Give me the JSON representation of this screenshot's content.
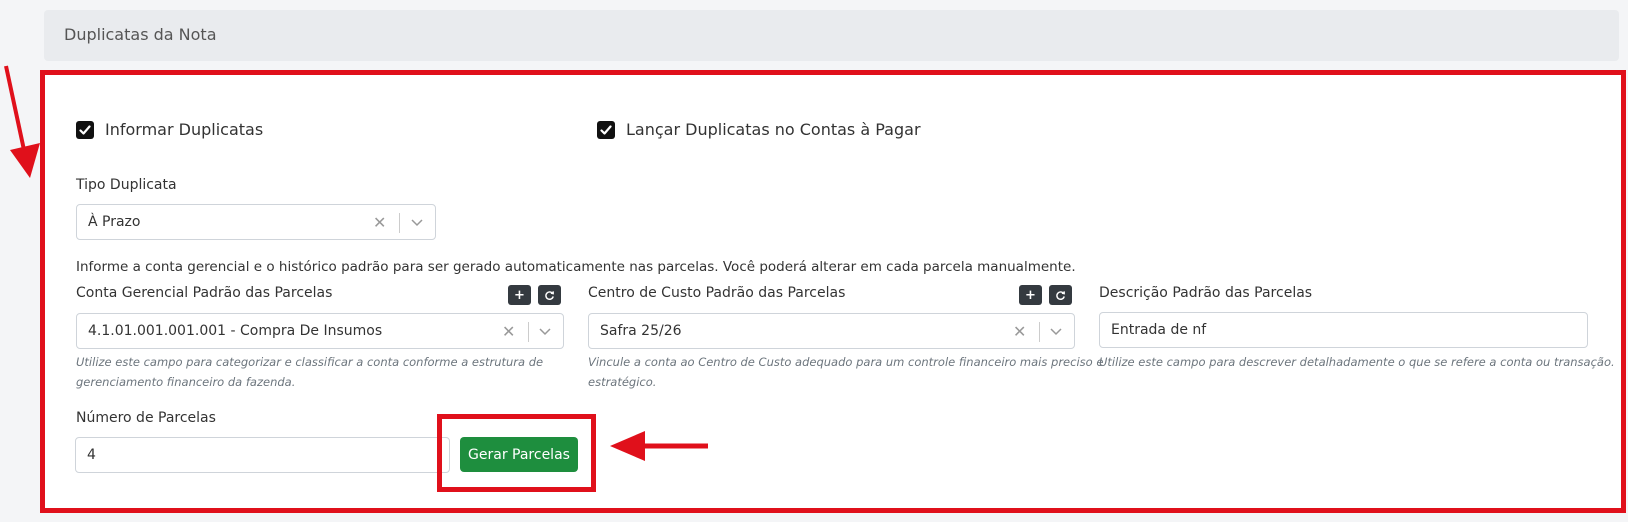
{
  "header": {
    "title": "Duplicatas da Nota"
  },
  "checkboxes": {
    "informar": {
      "label": "Informar Duplicatas",
      "checked": true
    },
    "lancar": {
      "label": "Lançar Duplicatas no Contas à Pagar",
      "checked": true
    }
  },
  "tipo_duplicata": {
    "label": "Tipo Duplicata",
    "value": "À Prazo"
  },
  "info_text": "Informe a conta gerencial e o histórico padrão para ser gerado automaticamente nas parcelas. Você poderá alterar em cada parcela manualmente.",
  "conta_gerencial": {
    "label": "Conta Gerencial Padrão das Parcelas",
    "value": "4.1.01.001.001.001 - Compra De Insumos",
    "help_line1": "Utilize este campo para categorizar e classificar a conta conforme a estrutura de",
    "help_line2": "gerenciamento financeiro da fazenda."
  },
  "centro_custo": {
    "label": "Centro de Custo Padrão das Parcelas",
    "value": "Safra 25/26",
    "help_line1": "Vincule a conta ao Centro de Custo adequado para um controle financeiro mais preciso e",
    "help_line2": "estratégico."
  },
  "descricao": {
    "label": "Descrição Padrão das Parcelas",
    "value": "Entrada de nf",
    "help": "Utilize este campo para descrever detalhadamente o que se refere a conta ou transação."
  },
  "numero_parcelas": {
    "label": "Número de Parcelas",
    "value": "4"
  },
  "gerar_button": {
    "label": "Gerar Parcelas"
  },
  "colors": {
    "accent_green": "#1e8e3e",
    "annotation_red": "#e0101b",
    "dark_button": "#343a40"
  }
}
